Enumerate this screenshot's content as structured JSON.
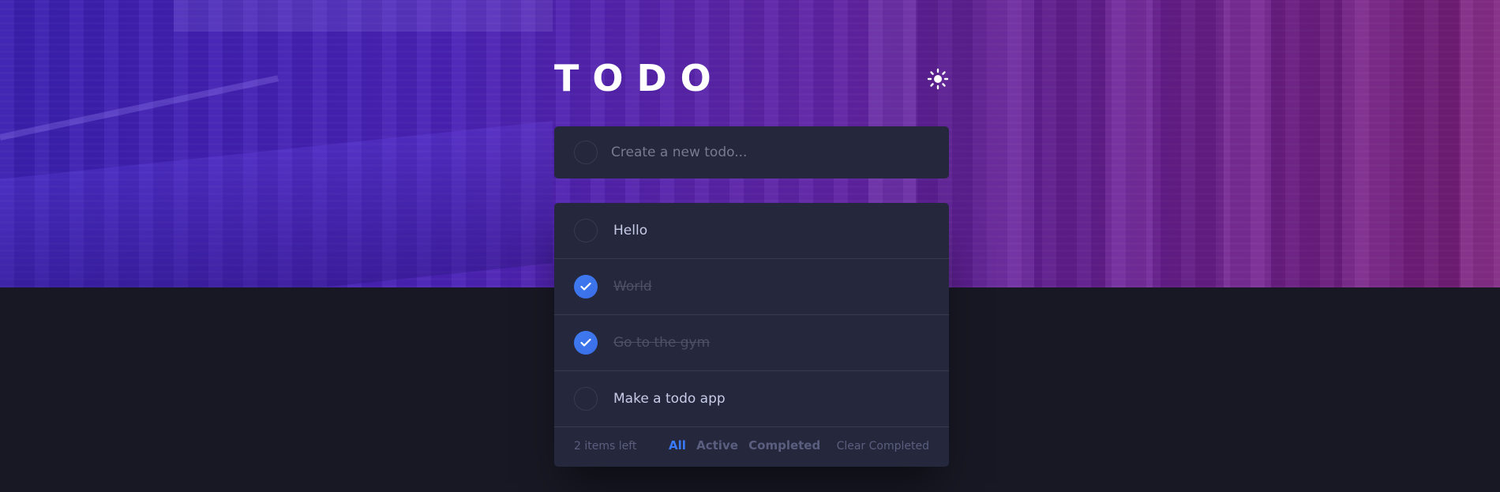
{
  "app": {
    "title": "TODO",
    "theme_icon": "sun-icon"
  },
  "new_todo": {
    "placeholder": "Create a new todo..."
  },
  "todos": [
    {
      "label": "Hello",
      "completed": false
    },
    {
      "label": "World",
      "completed": true
    },
    {
      "label": "Go to the gym",
      "completed": true
    },
    {
      "label": "Make a todo app",
      "completed": false
    }
  ],
  "footer": {
    "items_left": "2 items left",
    "filters": [
      "All",
      "Active",
      "Completed"
    ],
    "active_filter": "All",
    "clear_label": "Clear Completed"
  },
  "colors": {
    "accent": "#3a7bfd",
    "card": "#25273c",
    "background": "#181824"
  }
}
